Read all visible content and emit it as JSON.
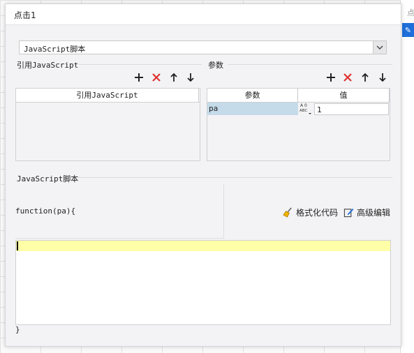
{
  "background": {
    "side_text": "点"
  },
  "dialog": {
    "title": "点击1",
    "script_type_select": {
      "value": "JavaScript脚本"
    },
    "ref_js": {
      "section_label": "引用JavaScript",
      "column_header": "引用JavaScript",
      "rows": []
    },
    "params": {
      "section_label": "参数",
      "columns": [
        "参数",
        "值"
      ],
      "rows": [
        {
          "name": "pa",
          "type_icon": "abc-type-icon",
          "value": "1"
        }
      ]
    },
    "script": {
      "section_label": "JavaScript脚本",
      "function_header": "function(pa){",
      "body": "",
      "closing": "}",
      "format_button": "格式化代码",
      "advanced_button": "高级编辑"
    },
    "toolbar_icons": [
      "plus-icon",
      "delete-icon",
      "arrow-up-icon",
      "arrow-down-icon"
    ],
    "colors": {
      "accent_blue": "#1e6fd9",
      "delete_red": "#e0322f",
      "selected_row": "#c5dbe9",
      "current_line": "#ffffa8"
    }
  }
}
